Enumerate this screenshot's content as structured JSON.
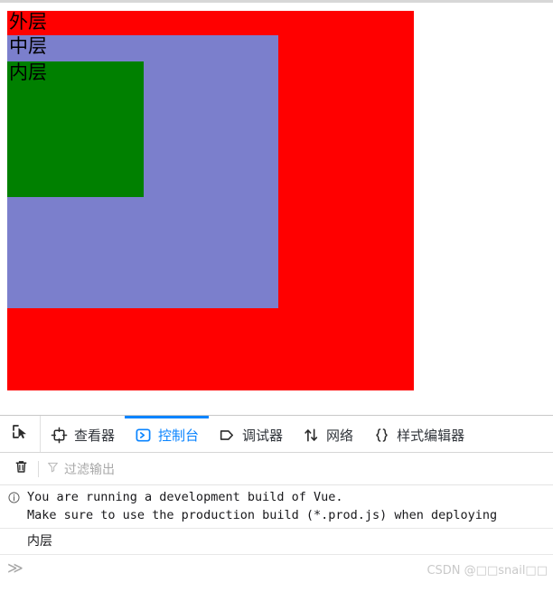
{
  "page": {
    "boxes": {
      "outer": {
        "label": "外层",
        "color": "#ff0000"
      },
      "middle": {
        "label": "中层",
        "color": "#7b7fcc"
      },
      "inner": {
        "label": "内层",
        "color": "#008000"
      }
    }
  },
  "devtools": {
    "picker": {
      "name": "element-picker",
      "icon": "picker-icon"
    },
    "tabs": [
      {
        "label": "查看器",
        "icon": "inspector-icon",
        "active": false
      },
      {
        "label": "控制台",
        "icon": "console-icon",
        "active": true
      },
      {
        "label": "调试器",
        "icon": "debugger-icon",
        "active": false
      },
      {
        "label": "网络",
        "icon": "network-icon",
        "active": false
      },
      {
        "label": "样式编辑器",
        "icon": "style-editor-icon",
        "active": false
      }
    ],
    "accent_color": "#0a84ff",
    "filterbar": {
      "clear_label": "trash-icon",
      "filter_icon": "funnel-icon",
      "filter_placeholder": "过滤输出"
    },
    "console": {
      "messages": [
        {
          "icon": "info-icon",
          "line1": "You are running a development build of Vue.",
          "line2": "Make sure to use the production build (*.prod.js) when deploying"
        },
        {
          "icon": "",
          "text": "内层"
        }
      ],
      "prompt_symbol": "≫"
    }
  },
  "watermark": "CSDN @□□snail□□"
}
